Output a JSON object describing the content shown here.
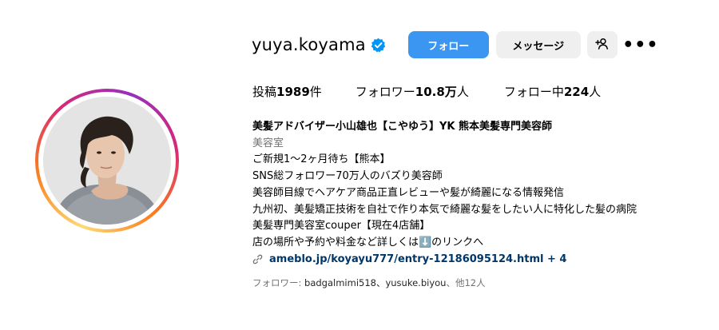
{
  "profile": {
    "username": "yuya.koyama",
    "verified_icon": "verified-badge-icon",
    "accent_color": "#3a96f0"
  },
  "actions": {
    "follow_label": "フォロー",
    "message_label": "メッセージ",
    "add_user_icon": "add-user-icon",
    "more_label": "•••"
  },
  "stats": {
    "posts_label": "投稿",
    "posts_value": "1989",
    "posts_unit": "件",
    "followers_label": "フォロワー",
    "followers_value": "10.8万",
    "followers_unit": "人",
    "following_label": "フォロー中",
    "following_value": "224",
    "following_unit": "人"
  },
  "bio": {
    "name": "美髪アドバイザー小山雄也【こやゆう】YK 熊本美髪専門美容師",
    "category": "美容室",
    "lines": [
      "ご新規1〜2ヶ月待ち【熊本】",
      "SNS総フォロワー70万人のバズり美容師",
      "美容師目線でヘアケア商品正直レビューや髪が綺麗になる情報発信",
      "九州初、美髪矯正技術を自社で作り本気で綺麗な髪をしたい人に特化した髪の病院",
      "美髪専門美容室couper【現在4店舗】",
      "店の場所や予約や料金など詳しくは⬇️のリンクへ"
    ],
    "link_text": "ameblo.jp/koyayu777/entry-12186095124.html + 4"
  },
  "followed_by": {
    "prefix": "フォロワー: ",
    "names": "badgalmimi518、yusuke.biyou",
    "suffix": "、他12人"
  }
}
